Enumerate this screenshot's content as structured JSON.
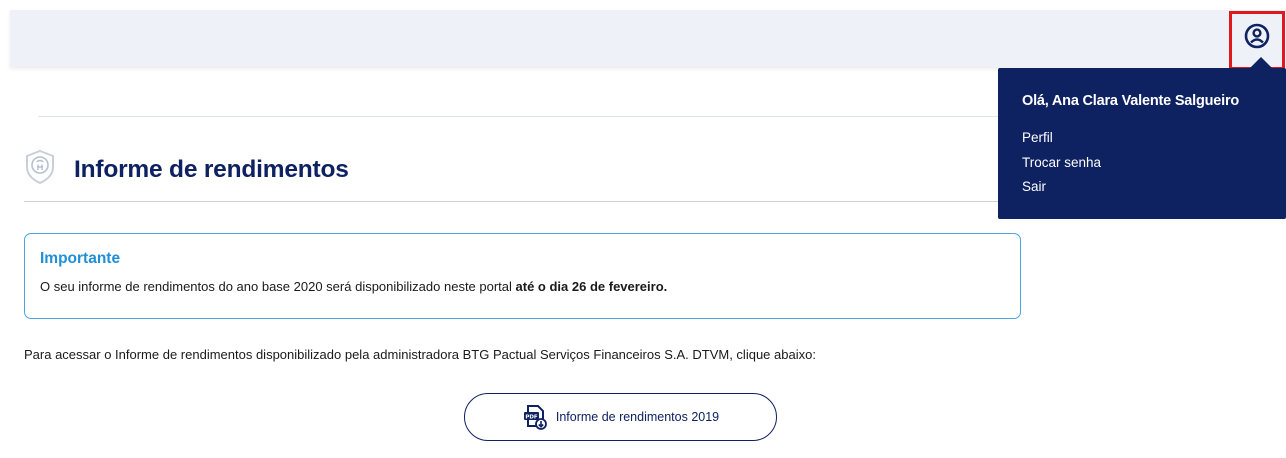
{
  "header": {
    "user_icon": "user-circle-icon"
  },
  "user_menu": {
    "greeting": "Olá, Ana Clara Valente Salgueiro",
    "items": [
      {
        "label": "Perfil"
      },
      {
        "label": "Trocar senha"
      },
      {
        "label": "Sair"
      }
    ]
  },
  "page": {
    "title": "Informe de rendimentos",
    "title_icon": "shield-badge-icon"
  },
  "notice": {
    "title": "Importante",
    "text": "O seu informe de rendimentos do ano base 2020 será disponibilizado neste portal ",
    "text_bold": "até o dia 26 de fevereiro."
  },
  "access": {
    "text": "Para acessar o Informe de rendimentos disponibilizado pela administradora BTG Pactual Serviços Financeiros S.A. DTVM, clique abaixo:"
  },
  "download_button": {
    "label": "Informe de rendimentos 2019",
    "icon": "pdf-download-icon"
  },
  "colors": {
    "navy": "#0e2161",
    "accent_blue": "#1f8fd6",
    "highlight_red": "#e0191e",
    "topbar_bg": "#eef1f8"
  }
}
